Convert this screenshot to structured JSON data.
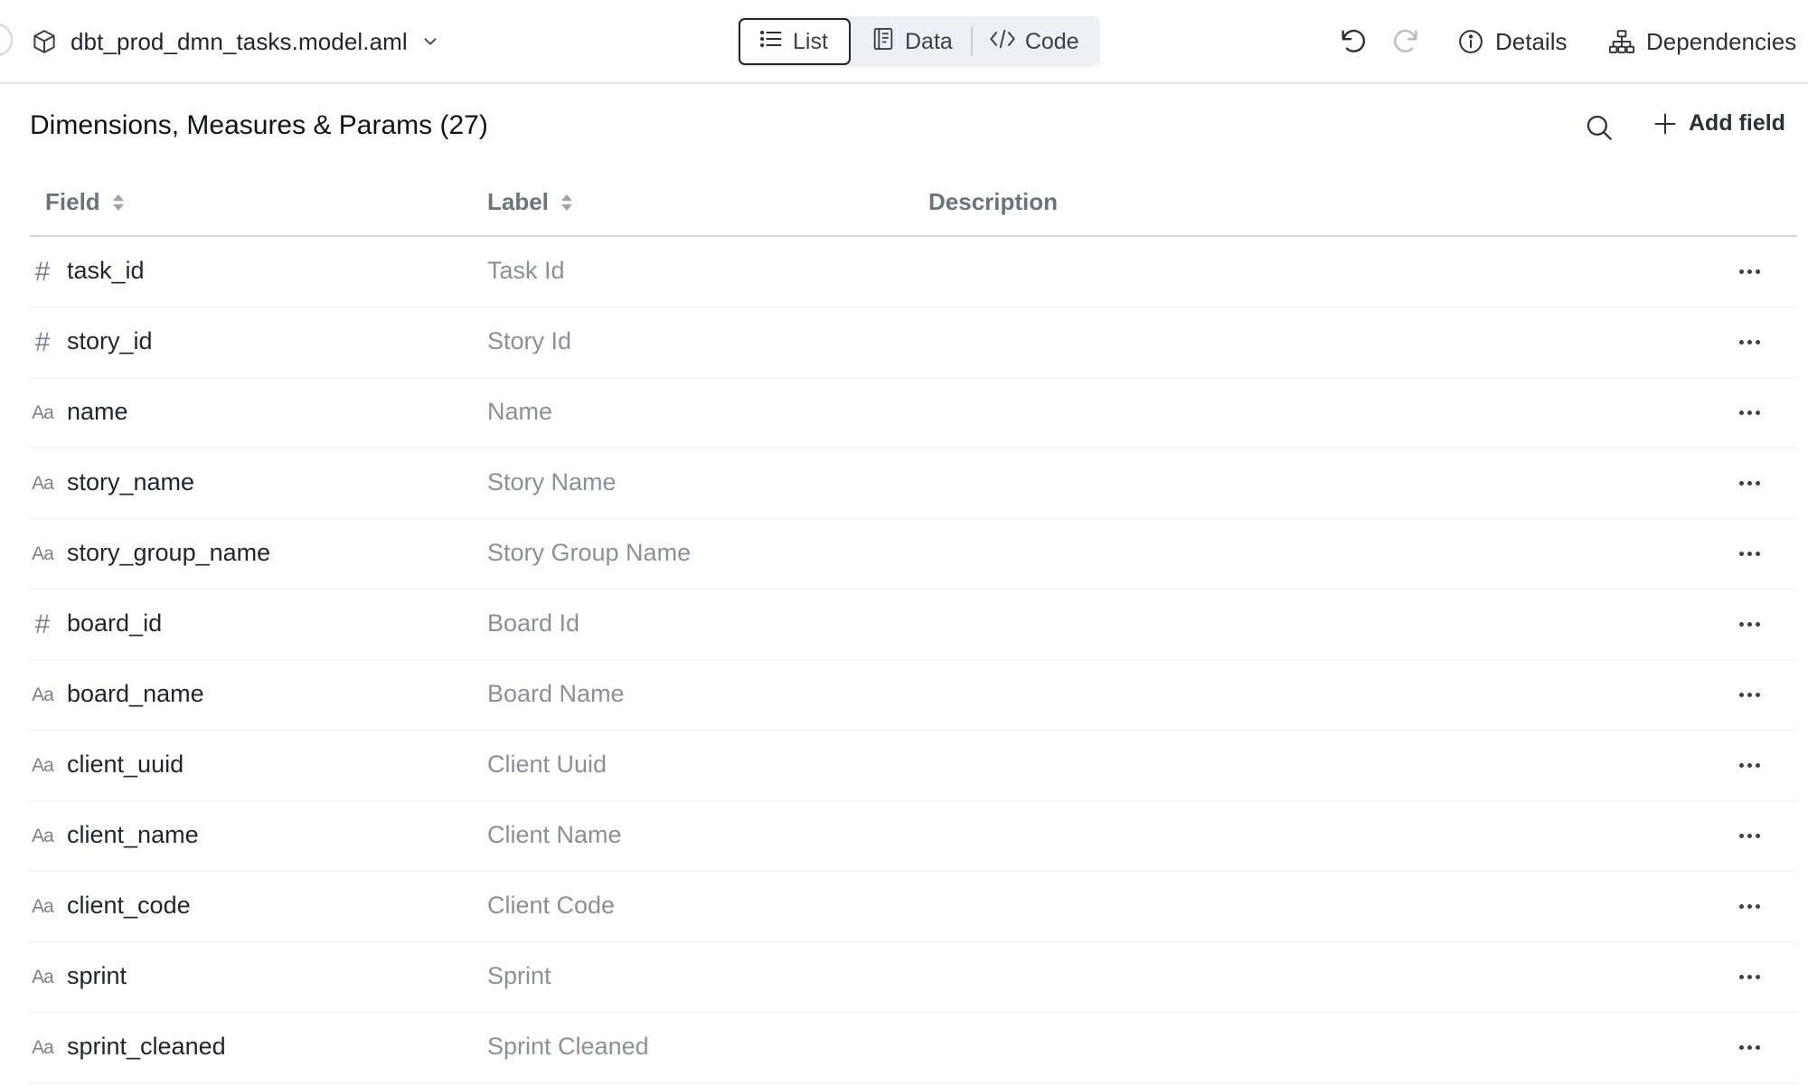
{
  "header": {
    "model_name": "dbt_prod_dmn_tasks.model.aml",
    "views": [
      {
        "label": "List",
        "active": true
      },
      {
        "label": "Data",
        "active": false
      },
      {
        "label": "Code",
        "active": false
      }
    ],
    "details_label": "Details",
    "dependencies_label": "Dependencies"
  },
  "section": {
    "title": "Dimensions, Measures & Params (27)",
    "add_field_label": "Add field"
  },
  "table": {
    "columns": [
      "Field",
      "Label",
      "Description"
    ],
    "rows": [
      {
        "type": "number",
        "field": "task_id",
        "label": "Task Id",
        "description": ""
      },
      {
        "type": "number",
        "field": "story_id",
        "label": "Story Id",
        "description": ""
      },
      {
        "type": "text",
        "field": "name",
        "label": "Name",
        "description": ""
      },
      {
        "type": "text",
        "field": "story_name",
        "label": "Story Name",
        "description": ""
      },
      {
        "type": "text",
        "field": "story_group_name",
        "label": "Story Group Name",
        "description": ""
      },
      {
        "type": "number",
        "field": "board_id",
        "label": "Board Id",
        "description": ""
      },
      {
        "type": "text",
        "field": "board_name",
        "label": "Board Name",
        "description": ""
      },
      {
        "type": "text",
        "field": "client_uuid",
        "label": "Client Uuid",
        "description": ""
      },
      {
        "type": "text",
        "field": "client_name",
        "label": "Client Name",
        "description": ""
      },
      {
        "type": "text",
        "field": "client_code",
        "label": "Client Code",
        "description": ""
      },
      {
        "type": "text",
        "field": "sprint",
        "label": "Sprint",
        "description": ""
      },
      {
        "type": "text",
        "field": "sprint_cleaned",
        "label": "Sprint Cleaned",
        "description": ""
      }
    ]
  },
  "type_icons": {
    "number": "#",
    "text": "Aa"
  },
  "colors": {
    "accent_border": "#20242c",
    "segmented_bg": "#eef0f3",
    "muted_text": "#8a8f99"
  }
}
